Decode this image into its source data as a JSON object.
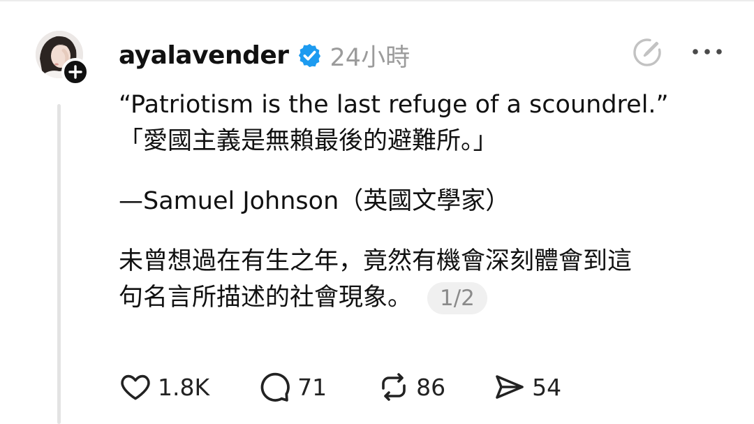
{
  "post": {
    "username": "ayalavender",
    "timestamp": "24小時",
    "text": {
      "quote_en": "“Patriotism is the last refuge of a scoundrel.”",
      "quote_zh": "「愛國主義是無賴最後的避難所。」",
      "attribution": "—Samuel Johnson（英國文學家）",
      "body_line1": "未曾想過在有生之年，竟然有機會深刻體會到這",
      "body_line2": "句名言所描述的社會現象。"
    },
    "page_counter": "1/2"
  },
  "actions": {
    "likes": "1.8K",
    "replies": "71",
    "reposts": "86",
    "shares": "54"
  },
  "icons": {
    "verified": "verified-badge-icon",
    "edit": "edit-icon",
    "more": "more-icon",
    "like": "heart-icon",
    "reply": "comment-icon",
    "repost": "repost-icon",
    "share": "send-icon",
    "follow": "plus-icon"
  },
  "colors": {
    "verified_blue": "#1d9bf0",
    "timestamp_gray": "#9b9b9b",
    "text": "#111111",
    "icon_gray": "#c2c2c2"
  }
}
